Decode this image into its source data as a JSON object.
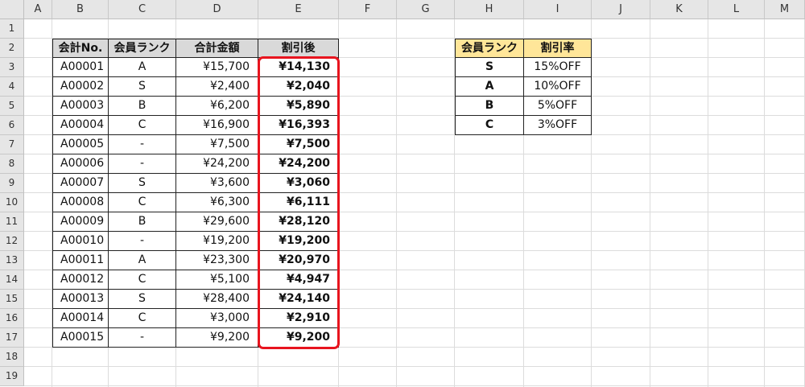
{
  "columns": [
    "A",
    "B",
    "C",
    "D",
    "E",
    "F",
    "G",
    "H",
    "I",
    "J",
    "K",
    "L",
    "M"
  ],
  "rows": [
    "1",
    "2",
    "3",
    "4",
    "5",
    "6",
    "7",
    "8",
    "9",
    "10",
    "11",
    "12",
    "13",
    "14",
    "15",
    "16",
    "17",
    "18",
    "19"
  ],
  "main_table": {
    "headers": [
      "会計No.",
      "会員ランク",
      "合計金額",
      "割引後"
    ],
    "rows": [
      [
        "A00001",
        "A",
        "¥15,700",
        "¥14,130"
      ],
      [
        "A00002",
        "S",
        "¥2,400",
        "¥2,040"
      ],
      [
        "A00003",
        "B",
        "¥6,200",
        "¥5,890"
      ],
      [
        "A00004",
        "C",
        "¥16,900",
        "¥16,393"
      ],
      [
        "A00005",
        "-",
        "¥7,500",
        "¥7,500"
      ],
      [
        "A00006",
        "-",
        "¥24,200",
        "¥24,200"
      ],
      [
        "A00007",
        "S",
        "¥3,600",
        "¥3,060"
      ],
      [
        "A00008",
        "C",
        "¥6,300",
        "¥6,111"
      ],
      [
        "A00009",
        "B",
        "¥29,600",
        "¥28,120"
      ],
      [
        "A00010",
        "-",
        "¥19,200",
        "¥19,200"
      ],
      [
        "A00011",
        "A",
        "¥23,300",
        "¥20,970"
      ],
      [
        "A00012",
        "C",
        "¥5,100",
        "¥4,947"
      ],
      [
        "A00013",
        "S",
        "¥28,400",
        "¥24,140"
      ],
      [
        "A00014",
        "C",
        "¥3,000",
        "¥2,910"
      ],
      [
        "A00015",
        "-",
        "¥9,200",
        "¥9,200"
      ]
    ]
  },
  "rank_table": {
    "headers": [
      "会員ランク",
      "割引率"
    ],
    "rows": [
      [
        "S",
        "15%OFF"
      ],
      [
        "A",
        "10%OFF"
      ],
      [
        "B",
        "5%OFF"
      ],
      [
        "C",
        "3%OFF"
      ]
    ]
  },
  "colors": {
    "header_gray": "#d9d9d9",
    "header_gold": "#ffe699",
    "highlight_red": "#e8141e",
    "grid": "#dcdcdc"
  }
}
